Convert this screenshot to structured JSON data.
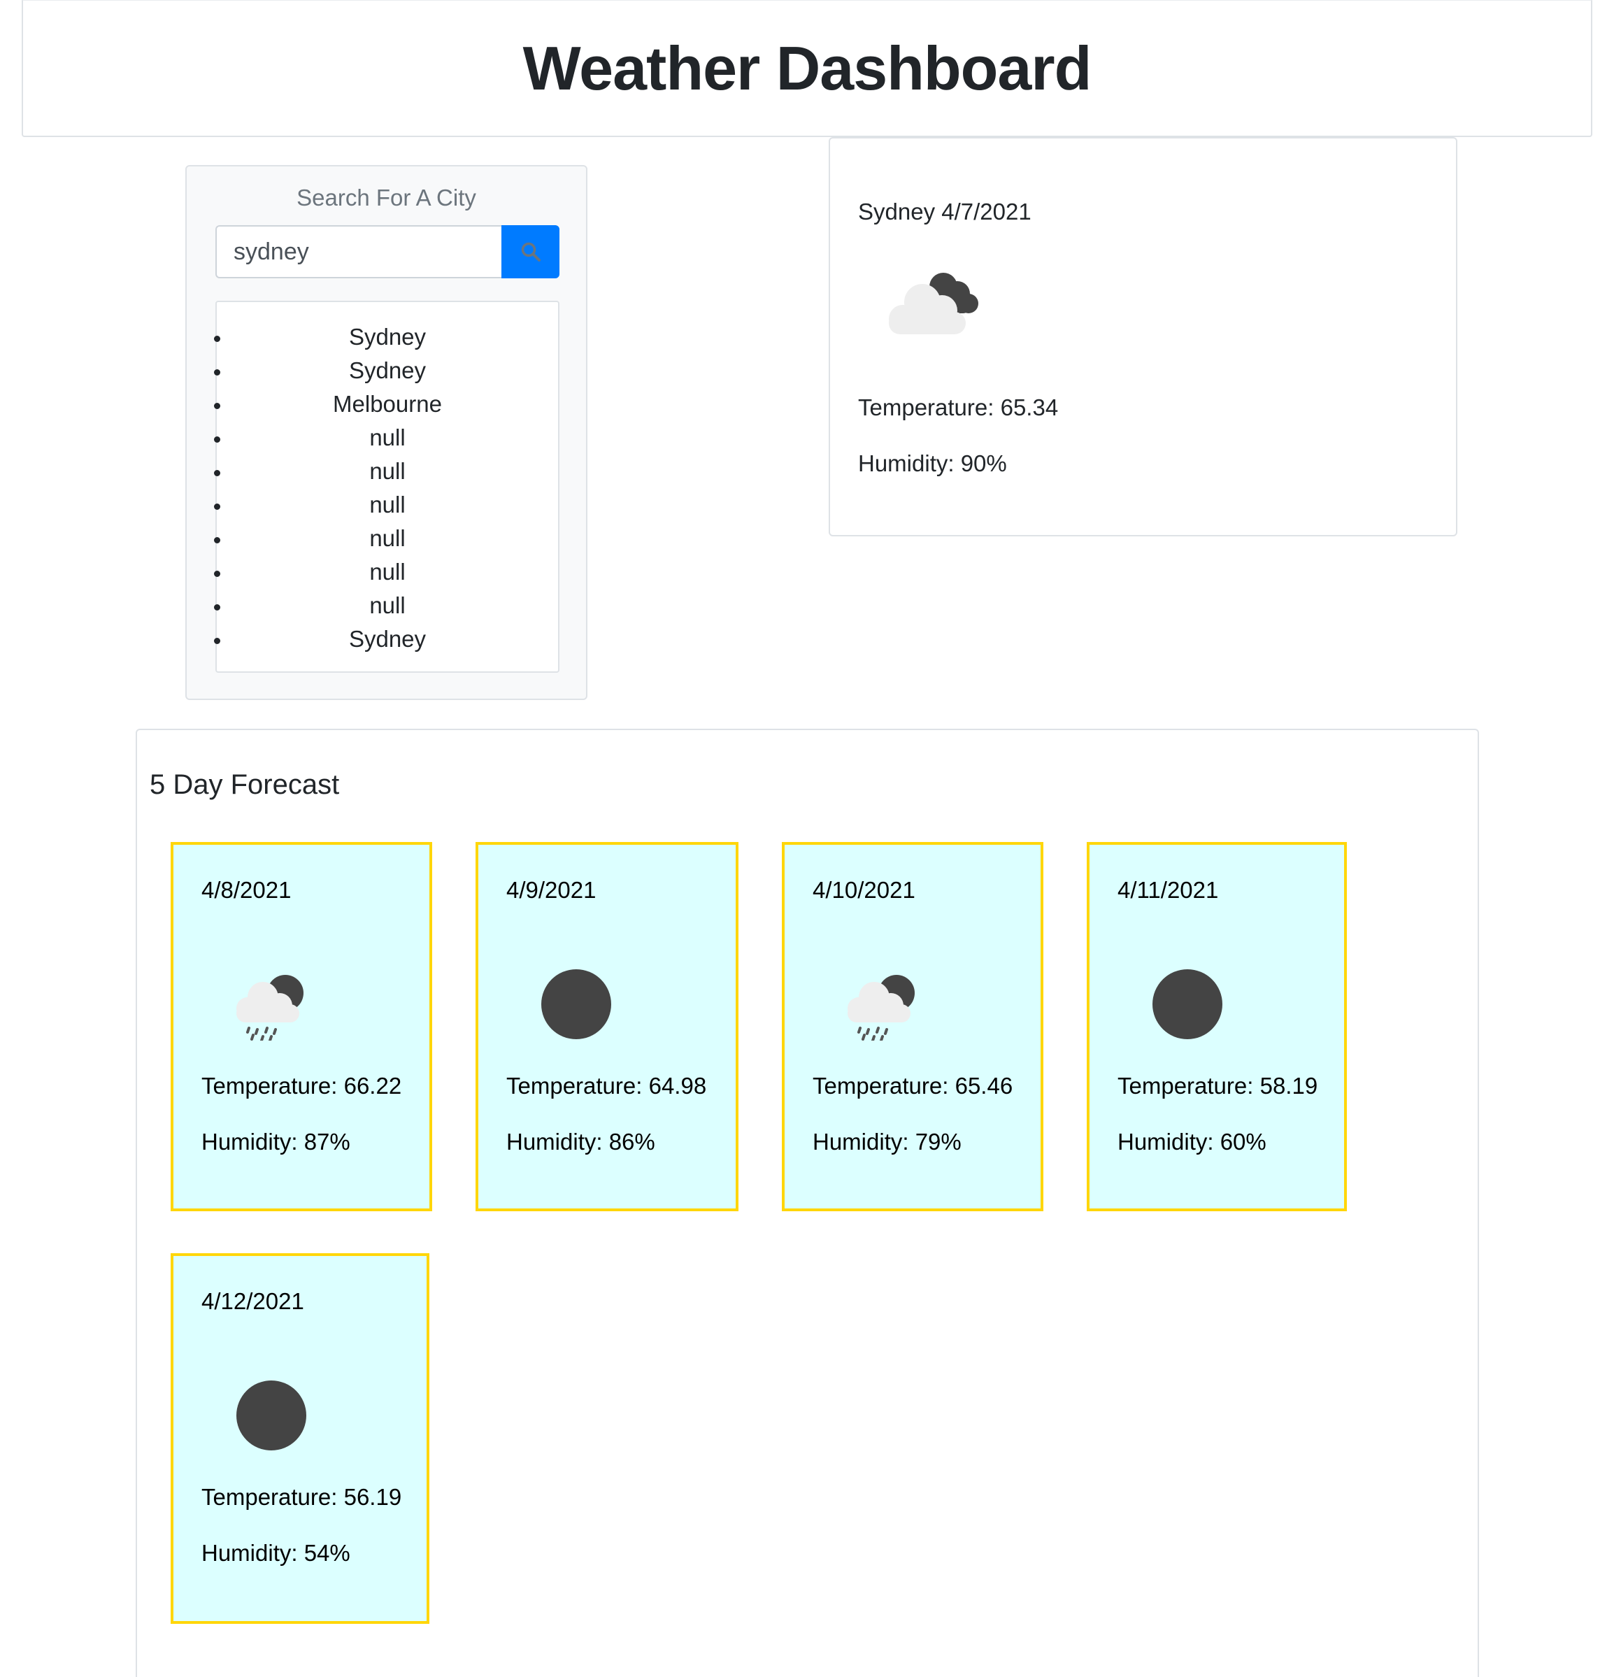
{
  "header": {
    "title": "Weather Dashboard"
  },
  "search": {
    "title": "Search For A City",
    "input_value": "sydney",
    "button_icon": "search-icon",
    "history": [
      "Sydney",
      "Sydney",
      "Melbourne",
      "null",
      "null",
      "null",
      "null",
      "null",
      "null",
      "Sydney"
    ]
  },
  "current": {
    "city_date": "Sydney 4/7/2021",
    "icon": "broken-clouds-icon",
    "temperature": "Temperature: 65.34",
    "humidity": "Humidity: 90%"
  },
  "forecast": {
    "title": "5 Day Forecast",
    "days": [
      {
        "date": "4/8/2021",
        "icon": "rain-icon",
        "temperature": "Temperature: 66.22",
        "humidity": "Humidity: 87%"
      },
      {
        "date": "4/9/2021",
        "icon": "clear-sky-icon",
        "temperature": "Temperature: 64.98",
        "humidity": "Humidity: 86%"
      },
      {
        "date": "4/10/2021",
        "icon": "rain-icon",
        "temperature": "Temperature: 65.46",
        "humidity": "Humidity: 79%"
      },
      {
        "date": "4/11/2021",
        "icon": "clear-sky-icon",
        "temperature": "Temperature: 58.19",
        "humidity": "Humidity: 60%"
      },
      {
        "date": "4/12/2021",
        "icon": "clear-sky-icon",
        "temperature": "Temperature: 56.19",
        "humidity": "Humidity: 54%"
      }
    ]
  },
  "colors": {
    "search_button": "#007bff",
    "forecast_card_bg": "#dcffff",
    "forecast_card_border": "#ffd60a",
    "icon_dark": "#444444",
    "icon_cloud": "#eeeeee"
  }
}
